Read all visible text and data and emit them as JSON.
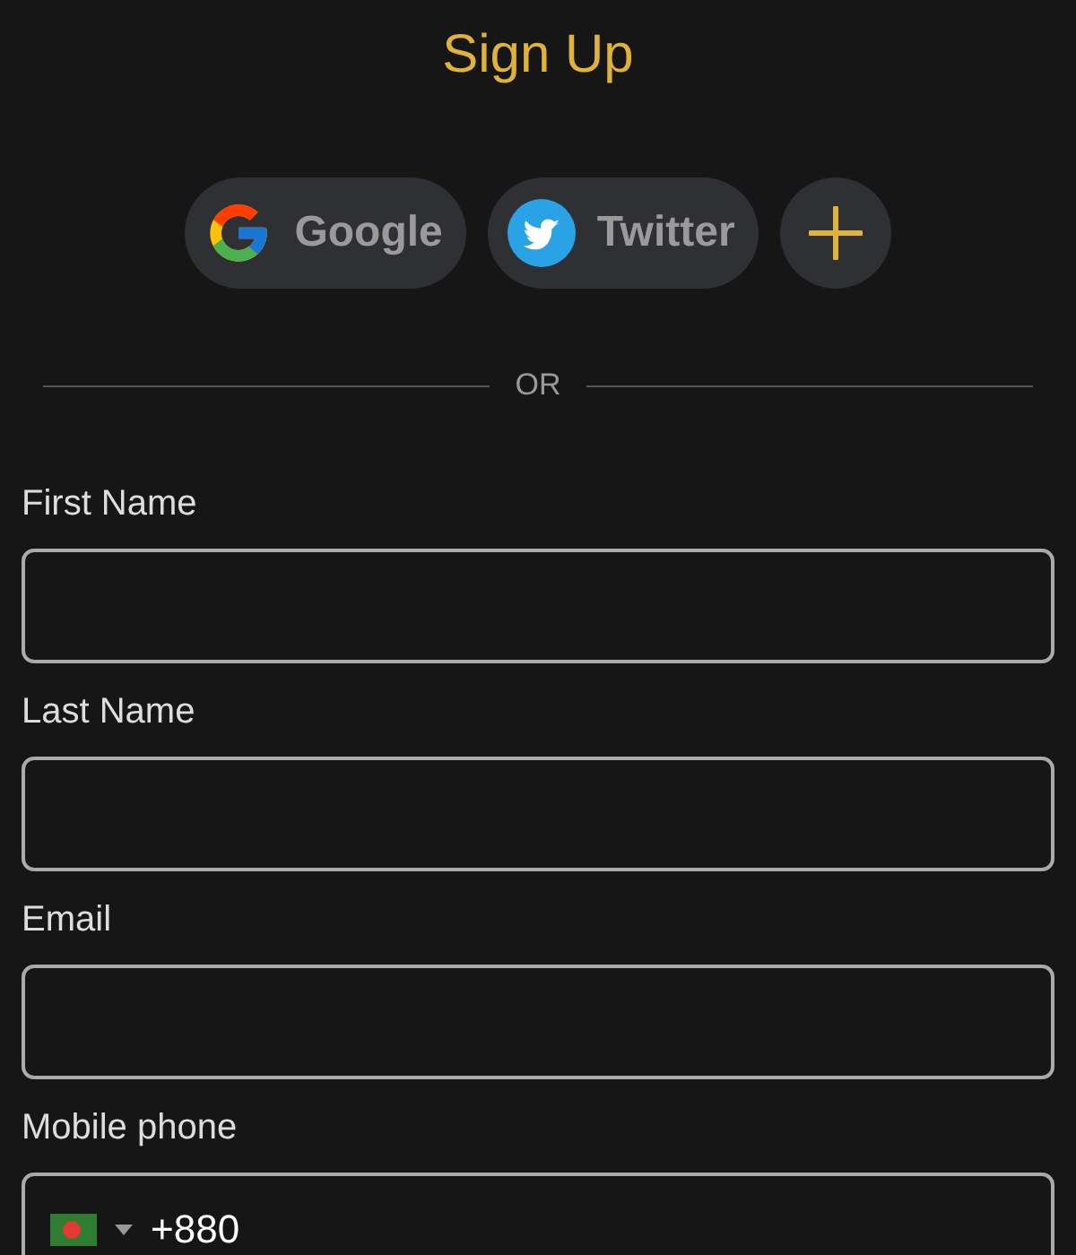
{
  "title": "Sign Up",
  "social": [
    {
      "kind": "google",
      "label": "Google"
    },
    {
      "kind": "twitter",
      "label": "Twitter"
    },
    {
      "kind": "more"
    }
  ],
  "divider": "OR",
  "fields": [
    {
      "kind": "text",
      "label": "First Name"
    },
    {
      "kind": "text",
      "label": "Last Name"
    },
    {
      "kind": "text",
      "label": "Email"
    },
    {
      "kind": "phone",
      "label": "Mobile phone",
      "dial_code": "+880"
    }
  ]
}
